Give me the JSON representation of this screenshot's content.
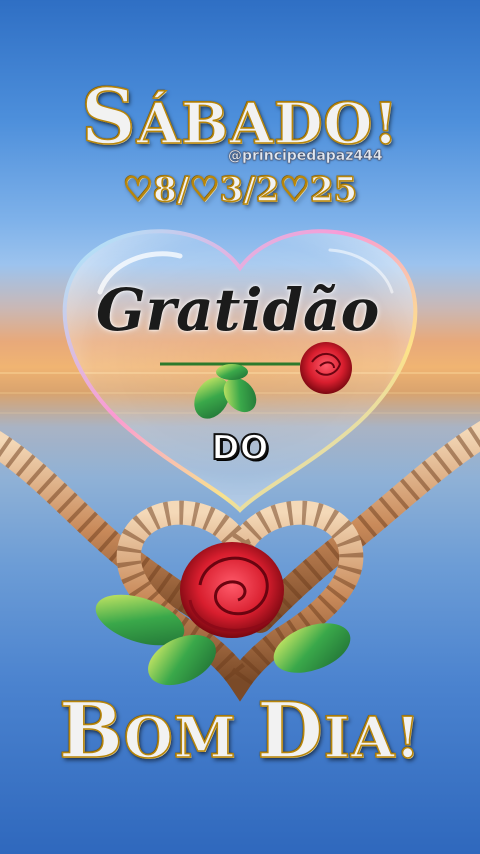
{
  "greeting": {
    "day_first_letter": "S",
    "day_rest": "ÁBADO!",
    "handle": "@principedapaz444",
    "date": "♡8/♡3/2♡25"
  },
  "bubble": {
    "word": "Gratidão",
    "connector": "DO"
  },
  "closing": {
    "b_first": "B",
    "b_rest": "OM ",
    "d_first": "D",
    "d_rest": "IA!"
  },
  "colors": {
    "gold": "#b8860b",
    "sky": "#4d8fdb",
    "rose": "#d81e2e",
    "leaf": "#3aa84a"
  },
  "icons": [
    "heart-bubble-icon",
    "rope-heart-icon",
    "rose-icon"
  ]
}
